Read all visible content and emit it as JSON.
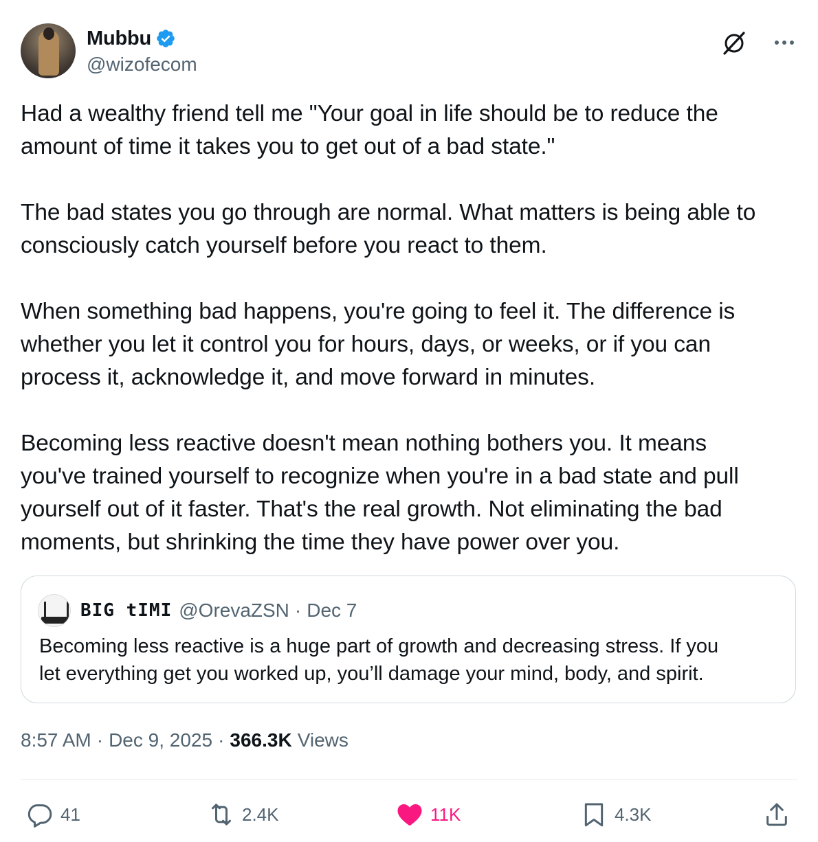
{
  "author": {
    "name": "Mubbu",
    "handle": "@wizofecom",
    "verified": true,
    "verified_color": "#1d9bf0"
  },
  "icons": {
    "grok": "grok-icon",
    "more": "more-options-icon"
  },
  "tweet": {
    "text": "Had a wealthy friend tell me \"Your goal in life should be to reduce the\namount of time it takes you to get out of a bad state.\"\n\nThe bad states you go through are normal. What matters is being able to\nconsciously catch yourself before you react to them.\n\nWhen something bad happens, you're going to feel it. The difference is\nwhether you let it control you for hours, days, or weeks, or if you can\nprocess it, acknowledge it, and move forward in minutes.\n\nBecoming less reactive doesn't mean nothing bothers you. It means\nyou've trained yourself to recognize when you're in a bad state and pull\nyourself out of it faster. That's the real growth. Not eliminating the bad\nmoments, but shrinking the time they have power over you."
  },
  "quote": {
    "name": "BIG tIMI",
    "handle": "@OrevaZSN",
    "separator": "·",
    "date": "Dec 7",
    "text": "Becoming less reactive is a huge part of growth and decreasing stress. If you\nlet everything get you worked up, you’ll damage your mind, body, and spirit."
  },
  "meta": {
    "time": "8:57 AM",
    "separator": "·",
    "date": "Dec 9, 2025",
    "views_count": "366.3K",
    "views_label": "Views"
  },
  "actions": {
    "replies": "41",
    "reposts": "2.4K",
    "likes": "11K",
    "bookmarks": "4.3K",
    "like_color": "#f91880"
  }
}
